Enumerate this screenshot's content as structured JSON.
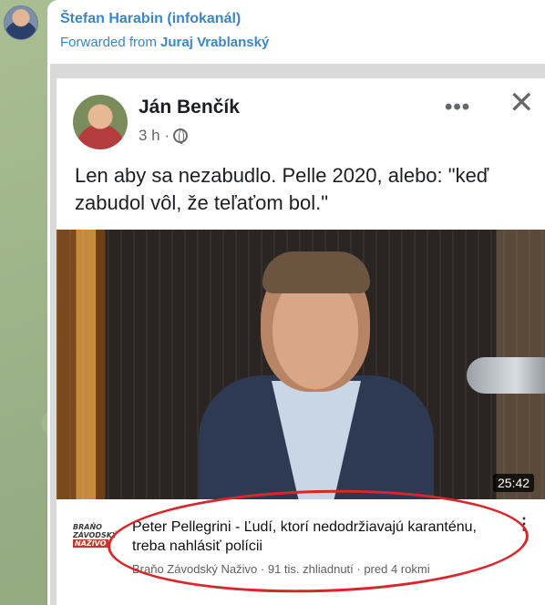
{
  "message": {
    "sender_name": "Štefan Harabin (infokanál)",
    "forwarded_prefix": "Forwarded from",
    "forwarded_name": "Juraj Vrablanský"
  },
  "facebook_post": {
    "author": "Ján Benčík",
    "time": "3 h ·",
    "text": "Len aby sa nezabudlo. Pelle 2020, alebo: \"keď zabudol vôl, že teľaťom bol.\"",
    "more_glyph": "•••",
    "close_glyph": "✕"
  },
  "video": {
    "duration": "25:42",
    "title": "Peter Pellegrini - Ľudí, ktorí nedodržiavajú karanténu, treba nahlásiť polícii",
    "meta": "Braňo Závodský Naživo · 91 tis. zhliadnutí · pred 4 rokmi",
    "channel_logo_lines": [
      "BRAŇO",
      "ZÁVODSKÝ",
      "NAŽIVO"
    ],
    "menu_glyph": "⋮"
  },
  "colors": {
    "telegram_link": "#3a87c7",
    "annotation_red": "#d8262a",
    "wallpaper": "#9fb58c"
  }
}
